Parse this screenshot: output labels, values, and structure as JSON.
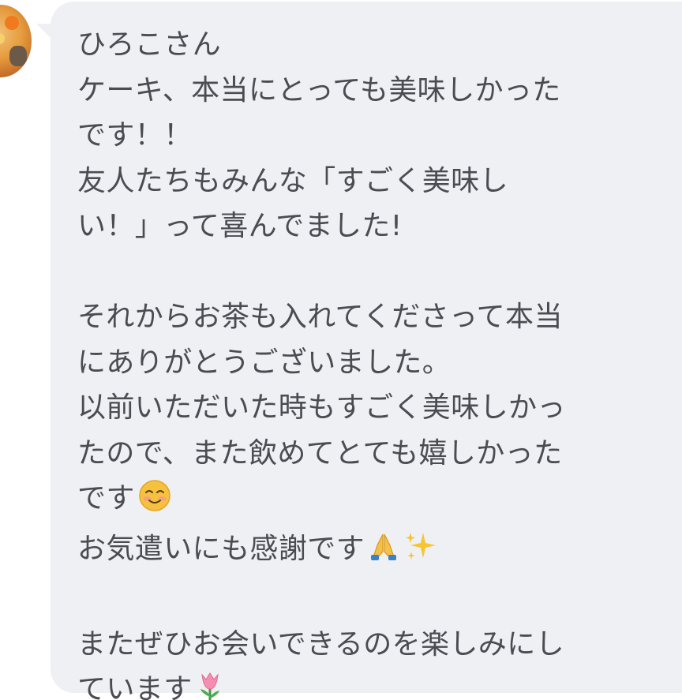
{
  "message": {
    "lines": [
      "ひろこさん",
      "ケーキ、本当にとっても美味しかった",
      "です！！",
      "友人たちもみんな「すごく美味し",
      "い！」って喜んでました!",
      "",
      "それからお茶も入れてくださって本当",
      "にありがとうございました。",
      "以前いただいた時もすごく美味しかっ",
      "たので、また飲めてとても嬉しかった",
      "です",
      "お気遣いにも感謝です",
      "",
      "またぜひお会いできるのを楽しみにし",
      "ています"
    ]
  },
  "emoji": {
    "smile": "smiling-face-icon",
    "pray": "folded-hands-icon",
    "sparkles": "sparkles-icon",
    "tulip": "tulip-icon"
  },
  "colors": {
    "bubble": "#eff0f3",
    "text": "#4b4b52",
    "background": "#ffffff"
  }
}
